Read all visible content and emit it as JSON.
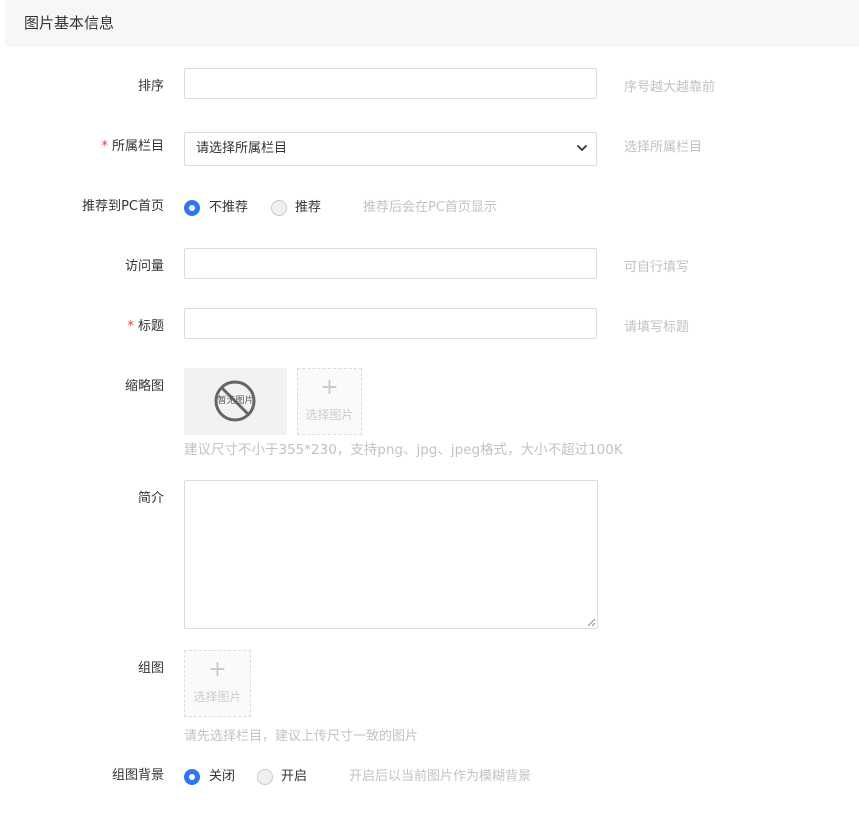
{
  "section": {
    "title": "图片基本信息"
  },
  "fields": {
    "sort": {
      "label": "排序",
      "value": "",
      "hint": "序号越大越靠前"
    },
    "category": {
      "label": "所属栏目",
      "required_mark": "*",
      "selected": "请选择所属栏目",
      "hint": "选择所属栏目"
    },
    "recommend": {
      "label": "推荐到PC首页",
      "options": [
        {
          "label": "不推荐",
          "checked": true
        },
        {
          "label": "推荐",
          "checked": false
        }
      ],
      "hint": "推荐后会在PC首页显示"
    },
    "views": {
      "label": "访问量",
      "value": "",
      "hint": "可自行填写"
    },
    "title": {
      "label": "标题",
      "required_mark": "*",
      "value": "",
      "hint": "请填写标题"
    },
    "thumbnail": {
      "label": "缩略图",
      "placeholder_text": "暂无图片",
      "upload_plus": "+",
      "upload_text": "选择图片",
      "hint": "建议尺寸不小于355*230，支持png、jpg、jpeg格式，大小不超过100K"
    },
    "intro": {
      "label": "简介",
      "value": ""
    },
    "gallery": {
      "label": "组图",
      "upload_plus": "+",
      "upload_text": "选择图片",
      "hint": "请先选择栏目，建议上传尺寸一致的图片"
    },
    "gallery_bg": {
      "label": "组图背景",
      "options": [
        {
          "label": "关闭",
          "checked": true
        },
        {
          "label": "开启",
          "checked": false
        }
      ],
      "hint": "开启后以当前图片作为模糊背景"
    }
  },
  "colors": {
    "accent": "#2e77f1",
    "required": "#e4393c",
    "hint": "#c2c2c2",
    "border": "#dcdcdc",
    "header_bg": "#f7f7f7"
  },
  "icons": {
    "select_arrow": "chevron-down-icon",
    "no_image": "no-image-icon",
    "resize": "resize-grip-icon"
  }
}
